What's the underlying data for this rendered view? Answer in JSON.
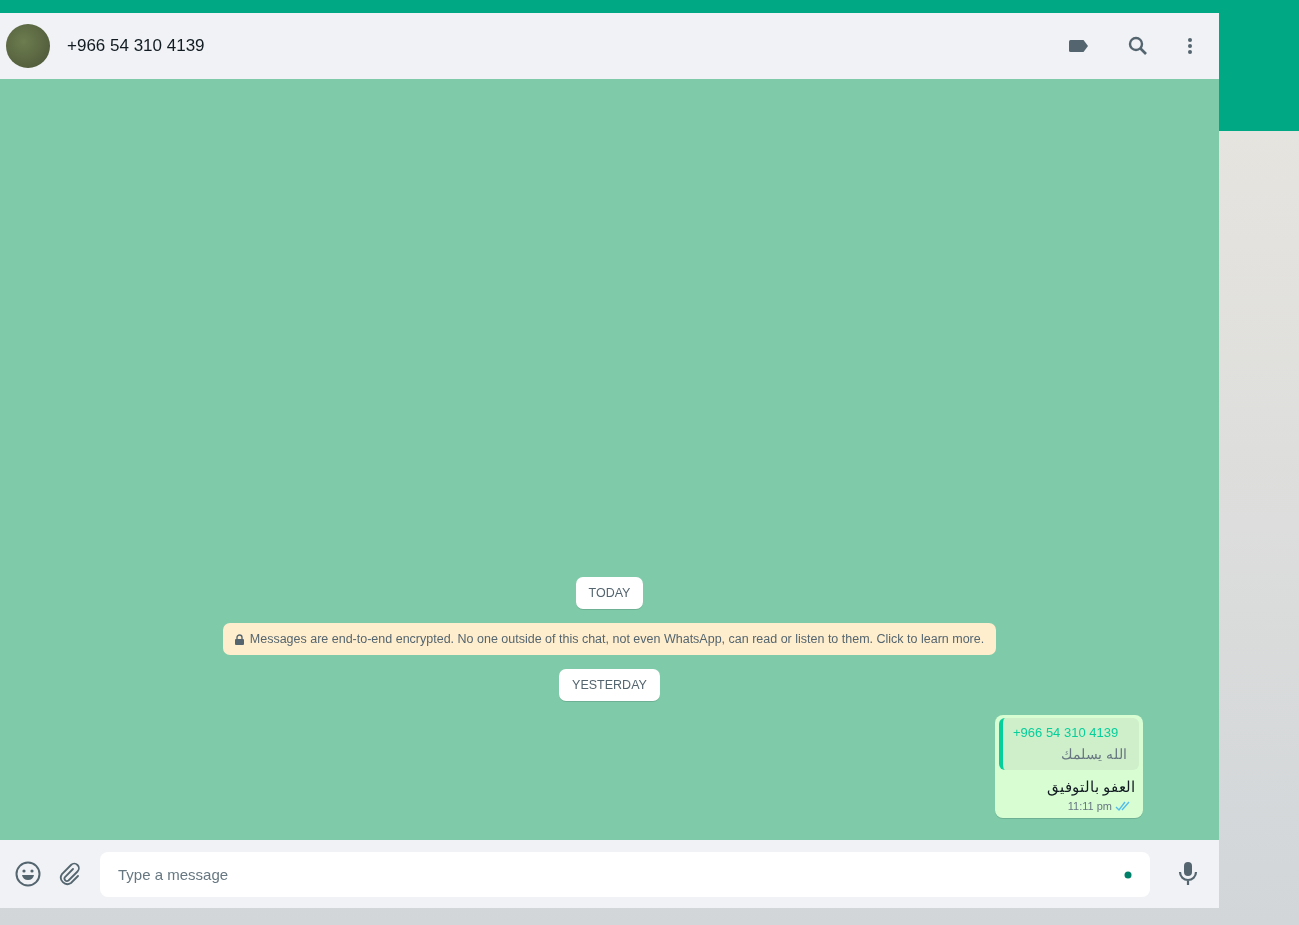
{
  "header": {
    "title": "+966 54 310 4139"
  },
  "chat": {
    "items": [
      {
        "kind": "date",
        "text": "TODAY"
      },
      {
        "kind": "notice",
        "text": "Messages are end-to-end encrypted. No one outside of this chat, not even WhatsApp, can read or listen to them. Click to learn more."
      },
      {
        "kind": "date",
        "text": "YESTERDAY"
      },
      {
        "kind": "message",
        "outgoing": true,
        "quote": {
          "author": "+966 54 310 4139",
          "text": "الله يسلمك"
        },
        "text": "العفو بالتوفيق",
        "time": "11:11 pm",
        "read": true
      }
    ]
  },
  "composer": {
    "placeholder": "Type a message"
  }
}
